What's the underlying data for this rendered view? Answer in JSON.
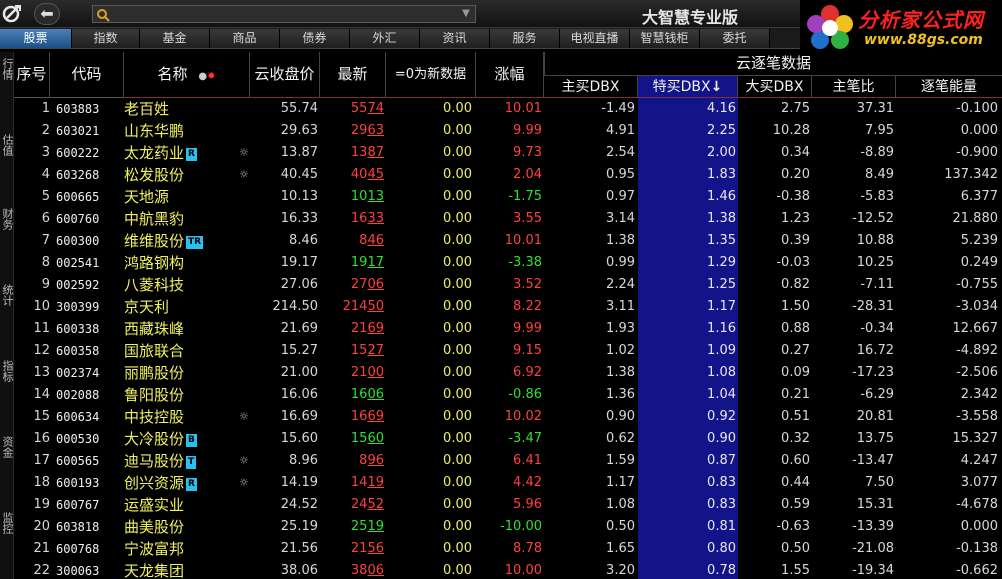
{
  "header": {
    "app_title": "大智慧专业版",
    "search": {
      "value": "",
      "placeholder": ""
    },
    "brand_name": "分析家公式网",
    "brand_url": "www.88gs.com"
  },
  "tabs": [
    {
      "label": "股票",
      "active": true
    },
    {
      "label": "指数",
      "active": false
    },
    {
      "label": "基金",
      "active": false
    },
    {
      "label": "商品",
      "active": false
    },
    {
      "label": "债券",
      "active": false
    },
    {
      "label": "外汇",
      "active": false
    },
    {
      "label": "资讯",
      "active": false
    },
    {
      "label": "服务",
      "active": false
    },
    {
      "label": "电视直播",
      "active": false
    },
    {
      "label": "智慧钱柜",
      "active": false
    },
    {
      "label": "委托",
      "active": false
    }
  ],
  "side_tabs": [
    "行情",
    "估值",
    "财务",
    "统计",
    "指标",
    "资金",
    "监控"
  ],
  "table": {
    "group_header": "云逐笔数据",
    "columns": {
      "idx": "序号",
      "code": "代码",
      "name": "名称",
      "close": "云收盘价",
      "latest": "最新",
      "newdata": "=0为新数据",
      "chg": "涨幅",
      "dbx": "主买DBX",
      "tdbx": "特买DBX",
      "bdbx": "大买DBX",
      "ratio": "主笔比",
      "energy": "逐笔能量"
    },
    "sort_indicator": "↓",
    "rows": [
      {
        "idx": "1",
        "code": "603883",
        "name": "老百姓",
        "tag": "",
        "star": "",
        "close": "55.74",
        "latest": "5574",
        "newdata": "0.00",
        "chg": "10.01",
        "dbx": "-1.49",
        "tdbx": "4.16",
        "bdbx": "2.75",
        "ratio": "37.31",
        "energy": "-0.100"
      },
      {
        "idx": "2",
        "code": "603021",
        "name": "山东华鹏",
        "tag": "",
        "star": "",
        "close": "29.63",
        "latest": "2963",
        "newdata": "0.00",
        "chg": "9.99",
        "dbx": "4.91",
        "tdbx": "2.25",
        "bdbx": "10.28",
        "ratio": "7.95",
        "energy": "0.000"
      },
      {
        "idx": "3",
        "code": "600222",
        "name": "太龙药业",
        "tag": "R",
        "star": "☼",
        "close": "13.87",
        "latest": "1387",
        "newdata": "0.00",
        "chg": "9.73",
        "dbx": "2.54",
        "tdbx": "2.00",
        "bdbx": "0.34",
        "ratio": "-8.89",
        "energy": "-0.900"
      },
      {
        "idx": "4",
        "code": "603268",
        "name": "松发股份",
        "tag": "",
        "star": "☼",
        "close": "40.45",
        "latest": "4045",
        "newdata": "0.00",
        "chg": "2.04",
        "dbx": "0.95",
        "tdbx": "1.83",
        "bdbx": "0.20",
        "ratio": "8.49",
        "energy": "137.342"
      },
      {
        "idx": "5",
        "code": "600665",
        "name": "天地源",
        "tag": "",
        "star": "",
        "close": "10.13",
        "latest": "1013",
        "newdata": "0.00",
        "chg": "-1.75",
        "dbx": "0.97",
        "tdbx": "1.46",
        "bdbx": "-0.38",
        "ratio": "-5.83",
        "energy": "6.377"
      },
      {
        "idx": "6",
        "code": "600760",
        "name": "中航黑豹",
        "tag": "",
        "star": "",
        "close": "16.33",
        "latest": "1633",
        "newdata": "0.00",
        "chg": "3.55",
        "dbx": "3.14",
        "tdbx": "1.38",
        "bdbx": "1.23",
        "ratio": "-12.52",
        "energy": "21.880"
      },
      {
        "idx": "7",
        "code": "600300",
        "name": "维维股份",
        "tag": "TR",
        "star": "",
        "close": "8.46",
        "latest": "846",
        "newdata": "0.00",
        "chg": "10.01",
        "dbx": "1.38",
        "tdbx": "1.35",
        "bdbx": "0.39",
        "ratio": "10.88",
        "energy": "5.239"
      },
      {
        "idx": "8",
        "code": "002541",
        "name": "鸿路钢构",
        "tag": "",
        "star": "",
        "close": "19.17",
        "latest": "1917",
        "newdata": "0.00",
        "chg": "-3.38",
        "dbx": "0.99",
        "tdbx": "1.29",
        "bdbx": "-0.03",
        "ratio": "10.25",
        "energy": "0.249"
      },
      {
        "idx": "9",
        "code": "002592",
        "name": "八菱科技",
        "tag": "",
        "star": "",
        "close": "27.06",
        "latest": "2706",
        "newdata": "0.00",
        "chg": "3.52",
        "dbx": "2.24",
        "tdbx": "1.25",
        "bdbx": "0.82",
        "ratio": "-7.11",
        "energy": "-0.755"
      },
      {
        "idx": "10",
        "code": "300399",
        "name": "京天利",
        "tag": "",
        "star": "",
        "close": "214.50",
        "latest": "21450",
        "newdata": "0.00",
        "chg": "8.22",
        "dbx": "3.11",
        "tdbx": "1.17",
        "bdbx": "1.50",
        "ratio": "-28.31",
        "energy": "-3.034"
      },
      {
        "idx": "11",
        "code": "600338",
        "name": "西藏珠峰",
        "tag": "",
        "star": "",
        "close": "21.69",
        "latest": "2169",
        "newdata": "0.00",
        "chg": "9.99",
        "dbx": "1.93",
        "tdbx": "1.16",
        "bdbx": "0.88",
        "ratio": "-0.34",
        "energy": "12.667"
      },
      {
        "idx": "12",
        "code": "600358",
        "name": "国旅联合",
        "tag": "",
        "star": "",
        "close": "15.27",
        "latest": "1527",
        "newdata": "0.00",
        "chg": "9.15",
        "dbx": "1.02",
        "tdbx": "1.09",
        "bdbx": "0.27",
        "ratio": "16.72",
        "energy": "-4.892"
      },
      {
        "idx": "13",
        "code": "002374",
        "name": "丽鹏股份",
        "tag": "",
        "star": "",
        "close": "21.00",
        "latest": "2100",
        "newdata": "0.00",
        "chg": "6.92",
        "dbx": "1.38",
        "tdbx": "1.08",
        "bdbx": "0.09",
        "ratio": "-17.23",
        "energy": "-2.506"
      },
      {
        "idx": "14",
        "code": "002088",
        "name": "鲁阳股份",
        "tag": "",
        "star": "",
        "close": "16.06",
        "latest": "1606",
        "newdata": "0.00",
        "chg": "-0.86",
        "dbx": "1.36",
        "tdbx": "1.04",
        "bdbx": "0.21",
        "ratio": "-6.29",
        "energy": "2.342"
      },
      {
        "idx": "15",
        "code": "600634",
        "name": "中技控股",
        "tag": "",
        "star": "☼",
        "close": "16.69",
        "latest": "1669",
        "newdata": "0.00",
        "chg": "10.02",
        "dbx": "0.90",
        "tdbx": "0.92",
        "bdbx": "0.51",
        "ratio": "20.81",
        "energy": "-3.558"
      },
      {
        "idx": "16",
        "code": "000530",
        "name": "大冷股份",
        "tag": "B",
        "star": "",
        "close": "15.60",
        "latest": "1560",
        "newdata": "0.00",
        "chg": "-3.47",
        "dbx": "0.62",
        "tdbx": "0.90",
        "bdbx": "0.32",
        "ratio": "13.75",
        "energy": "15.327"
      },
      {
        "idx": "17",
        "code": "600565",
        "name": "迪马股份",
        "tag": "T",
        "star": "☼",
        "close": "8.96",
        "latest": "896",
        "newdata": "0.00",
        "chg": "6.41",
        "dbx": "1.59",
        "tdbx": "0.87",
        "bdbx": "0.60",
        "ratio": "-13.47",
        "energy": "4.247"
      },
      {
        "idx": "18",
        "code": "600193",
        "name": "创兴资源",
        "tag": "R",
        "star": "☼",
        "close": "14.19",
        "latest": "1419",
        "newdata": "0.00",
        "chg": "4.42",
        "dbx": "1.17",
        "tdbx": "0.83",
        "bdbx": "0.44",
        "ratio": "7.50",
        "energy": "3.077"
      },
      {
        "idx": "19",
        "code": "600767",
        "name": "运盛实业",
        "tag": "",
        "star": "",
        "close": "24.52",
        "latest": "2452",
        "newdata": "0.00",
        "chg": "5.96",
        "dbx": "1.08",
        "tdbx": "0.83",
        "bdbx": "0.59",
        "ratio": "15.31",
        "energy": "-4.678"
      },
      {
        "idx": "20",
        "code": "603818",
        "name": "曲美股份",
        "tag": "",
        "star": "",
        "close": "25.19",
        "latest": "2519",
        "newdata": "0.00",
        "chg": "-10.00",
        "dbx": "0.50",
        "tdbx": "0.81",
        "bdbx": "-0.63",
        "ratio": "-13.39",
        "energy": "0.000"
      },
      {
        "idx": "21",
        "code": "600768",
        "name": "宁波富邦",
        "tag": "",
        "star": "",
        "close": "21.56",
        "latest": "2156",
        "newdata": "0.00",
        "chg": "8.78",
        "dbx": "1.65",
        "tdbx": "0.80",
        "bdbx": "0.50",
        "ratio": "-21.08",
        "energy": "-0.138"
      },
      {
        "idx": "22",
        "code": "300063",
        "name": "天龙集团",
        "tag": "",
        "star": "",
        "close": "38.06",
        "latest": "3806",
        "newdata": "0.00",
        "chg": "10.00",
        "dbx": "3.20",
        "tdbx": "0.78",
        "bdbx": "1.55",
        "ratio": "-19.34",
        "energy": "-0.662"
      }
    ]
  },
  "colors": {
    "up": "#ff4040",
    "down": "#30e030",
    "name": "#f0f060",
    "sort_bg": "#13138a",
    "active_tab": "#2c64a6"
  }
}
